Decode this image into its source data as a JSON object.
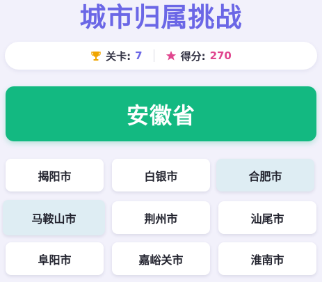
{
  "game": {
    "title": "城市归属挑战",
    "level_label": "关卡:",
    "level_value": "7",
    "score_label": "得分:",
    "score_value": "270",
    "prompt_province": "安徽省",
    "icons": [
      "trophy-icon",
      "star-icon"
    ],
    "colors": {
      "title": "#6b67e6",
      "level_value": "#6b67e6",
      "score_value": "#e0458e",
      "trophy": "#f0a500",
      "star": "#e0458e",
      "prompt_bg": "#13b981",
      "option_bg": "#ffffff",
      "option_selected_bg": "#deedf3"
    }
  },
  "options": [
    {
      "label": "揭阳市",
      "highlighted": false
    },
    {
      "label": "白银市",
      "highlighted": false
    },
    {
      "label": "合肥市",
      "highlighted": true
    },
    {
      "label": "马鞍山市",
      "highlighted": true
    },
    {
      "label": "荆州市",
      "highlighted": false
    },
    {
      "label": "汕尾市",
      "highlighted": false
    },
    {
      "label": "阜阳市",
      "highlighted": false
    },
    {
      "label": "嘉峪关市",
      "highlighted": false
    },
    {
      "label": "淮南市",
      "highlighted": false
    }
  ]
}
